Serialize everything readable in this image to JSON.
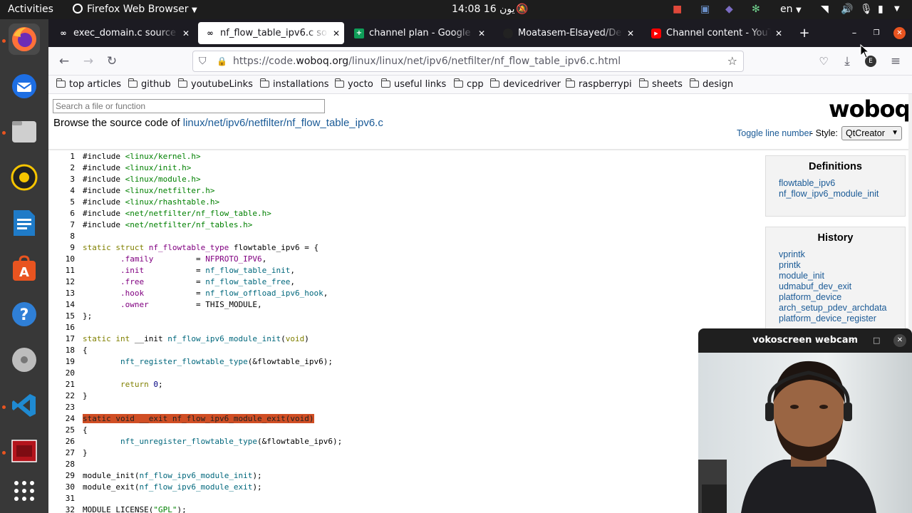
{
  "topbar": {
    "activities": "Activities",
    "app": "Firefox Web Browser",
    "clock": "14:08  يون 16",
    "lang": "en"
  },
  "dock": [
    "firefox-icon",
    "thunderbird-icon",
    "files-icon",
    "rhythmbox-icon",
    "writer-icon",
    "app-center-icon",
    "help-icon",
    "disks-icon",
    "vscode-icon",
    "screencast-icon",
    "show-apps-icon"
  ],
  "tabs": [
    {
      "title": "exec_domain.c source co",
      "icon": "woboq",
      "active": false
    },
    {
      "title": "nf_flow_table_ipv6.c sou",
      "icon": "woboq",
      "active": true
    },
    {
      "title": "channel plan - Google Sh",
      "icon": "sheets",
      "active": false
    },
    {
      "title": "Moatasem-Elsayed/Devic",
      "icon": "github",
      "active": false
    },
    {
      "title": "Channel content - YouTu",
      "icon": "youtube",
      "active": false
    }
  ],
  "url": {
    "prefix": "https://code.",
    "domain": "woboq.org",
    "path": "/linux/linux/net/ipv6/netfilter/nf_flow_table_ipv6.c.html"
  },
  "bookmarks": [
    "top articles",
    "github",
    "youtubeLinks",
    "installations",
    "yocto",
    "useful links",
    "cpp",
    "devicedriver",
    "raspberrypi",
    "sheets",
    "design"
  ],
  "page": {
    "search_placeholder": "Search a file or function",
    "browse_prefix": "Browse the source code of ",
    "path": [
      "linux",
      "/",
      "net",
      "/",
      "ipv6",
      "/",
      "netfilter",
      "/",
      "nf_flow_table_ipv6.c"
    ],
    "logo": "woboq",
    "toggle": "Toggle line number",
    "style_label": " - Style:",
    "style_value": "QtCreator"
  },
  "code": [
    {
      "n": "1",
      "t": [
        [
          "#include ",
          ""
        ],
        [
          "<linux/kernel.h>",
          "s"
        ]
      ]
    },
    {
      "n": "2",
      "t": [
        [
          "#include ",
          ""
        ],
        [
          "<linux/init.h>",
          "s"
        ]
      ]
    },
    {
      "n": "3",
      "t": [
        [
          "#include ",
          ""
        ],
        [
          "<linux/module.h>",
          "s"
        ]
      ]
    },
    {
      "n": "4",
      "t": [
        [
          "#include ",
          ""
        ],
        [
          "<linux/netfilter.h>",
          "s"
        ]
      ]
    },
    {
      "n": "5",
      "t": [
        [
          "#include ",
          ""
        ],
        [
          "<linux/rhashtable.h>",
          "s"
        ]
      ]
    },
    {
      "n": "6",
      "t": [
        [
          "#include ",
          ""
        ],
        [
          "<net/netfilter/nf_flow_table.h>",
          "s"
        ]
      ]
    },
    {
      "n": "7",
      "t": [
        [
          "#include ",
          ""
        ],
        [
          "<net/netfilter/nf_tables.h>",
          "s"
        ]
      ]
    },
    {
      "n": "8",
      "t": []
    },
    {
      "n": "9",
      "t": [
        [
          "static ",
          "k"
        ],
        [
          "struct ",
          "k"
        ],
        [
          "nf_flowtable_type",
          "m"
        ],
        [
          " flowtable_ipv6 = {",
          ""
        ]
      ]
    },
    {
      "n": "10",
      "t": [
        [
          "        ",
          ""
        ],
        [
          ".family",
          "m"
        ],
        [
          "         = ",
          ""
        ],
        [
          "NFPROTO_IPV6",
          "m"
        ],
        [
          ",",
          ""
        ]
      ]
    },
    {
      "n": "11",
      "t": [
        [
          "        ",
          ""
        ],
        [
          ".init",
          "m"
        ],
        [
          "           = ",
          ""
        ],
        [
          "nf_flow_table_init",
          "f"
        ],
        [
          ",",
          ""
        ]
      ]
    },
    {
      "n": "12",
      "t": [
        [
          "        ",
          ""
        ],
        [
          ".free",
          "m"
        ],
        [
          "           = ",
          ""
        ],
        [
          "nf_flow_table_free",
          "f"
        ],
        [
          ",",
          ""
        ]
      ]
    },
    {
      "n": "13",
      "t": [
        [
          "        ",
          ""
        ],
        [
          ".hook",
          "m"
        ],
        [
          "           = ",
          ""
        ],
        [
          "nf_flow_offload_ipv6_hook",
          "f"
        ],
        [
          ",",
          ""
        ]
      ]
    },
    {
      "n": "14",
      "t": [
        [
          "        ",
          ""
        ],
        [
          ".owner",
          "m"
        ],
        [
          "          = THIS_MODULE,",
          ""
        ]
      ]
    },
    {
      "n": "15",
      "t": [
        [
          "};",
          ""
        ]
      ]
    },
    {
      "n": "16",
      "t": []
    },
    {
      "n": "17",
      "t": [
        [
          "static ",
          "k"
        ],
        [
          "int ",
          "k"
        ],
        [
          "__init ",
          ""
        ],
        [
          "nf_flow_ipv6_module_init",
          "f"
        ],
        [
          "(",
          ""
        ],
        [
          "void",
          "k"
        ],
        [
          ")",
          ""
        ]
      ]
    },
    {
      "n": "18",
      "t": [
        [
          "{",
          ""
        ]
      ]
    },
    {
      "n": "19",
      "t": [
        [
          "        ",
          ""
        ],
        [
          "nft_register_flowtable_type",
          "f"
        ],
        [
          "(&flowtable_ipv6);",
          ""
        ]
      ]
    },
    {
      "n": "20",
      "t": []
    },
    {
      "n": "21",
      "t": [
        [
          "        ",
          ""
        ],
        [
          "return ",
          "k"
        ],
        [
          "0",
          "n"
        ],
        [
          ";",
          ""
        ]
      ]
    },
    {
      "n": "22",
      "t": [
        [
          "}",
          ""
        ]
      ]
    },
    {
      "n": "23",
      "t": []
    },
    {
      "n": "24",
      "t": [
        [
          "static void __exit nf_flow_ipv6_module_exit(void)",
          "hl"
        ]
      ]
    },
    {
      "n": "25",
      "t": [
        [
          "{",
          ""
        ]
      ]
    },
    {
      "n": "26",
      "t": [
        [
          "        ",
          ""
        ],
        [
          "nft_unregister_flowtable_type",
          "f"
        ],
        [
          "(&flowtable_ipv6);",
          ""
        ]
      ]
    },
    {
      "n": "27",
      "t": [
        [
          "}",
          ""
        ]
      ]
    },
    {
      "n": "28",
      "t": []
    },
    {
      "n": "29",
      "t": [
        [
          "module_init(",
          ""
        ],
        [
          "nf_flow_ipv6_module_init",
          "f"
        ],
        [
          ");",
          ""
        ]
      ]
    },
    {
      "n": "30",
      "t": [
        [
          "module_exit(",
          ""
        ],
        [
          "nf_flow_ipv6_module_exit",
          "f"
        ],
        [
          ");",
          ""
        ]
      ]
    },
    {
      "n": "31",
      "t": []
    },
    {
      "n": "32",
      "t": [
        [
          "MODULE_LICENSE(",
          ""
        ],
        [
          "\"GPL\"",
          "s"
        ],
        [
          ");",
          ""
        ]
      ]
    }
  ],
  "definitions": {
    "title": "Definitions",
    "items": [
      "flowtable_ipv6",
      "nf_flow_ipv6_module_init"
    ]
  },
  "history": {
    "title": "History",
    "items": [
      "vprintk",
      "printk",
      "module_init",
      "udmabuf_dev_exit",
      "platform_device",
      "arch_setup_pdev_archdata",
      "platform_device_register"
    ]
  },
  "webcam": {
    "title": "vokoscreen webcam"
  },
  "colors": {
    "accent": "#e95420",
    "highlight": "#d04e24",
    "link": "#1a5a96"
  }
}
